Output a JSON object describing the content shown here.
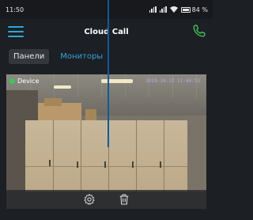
{
  "status_bar": {
    "time": "11:50",
    "battery": "84 %"
  },
  "header": {
    "title": "Cloud Call"
  },
  "tabs": [
    {
      "label": "Панели",
      "active": true
    },
    {
      "label": "Мониторы",
      "active": false
    }
  ],
  "camera": {
    "device_label": "Device",
    "timestamp": "2019-10-12  11:49:53",
    "status_color": "#38c95a"
  },
  "colors": {
    "accent": "#2fa6d8",
    "call": "#3dbb55"
  },
  "icons": [
    "menu-icon",
    "phone-icon",
    "settings-icon",
    "trash-icon"
  ]
}
